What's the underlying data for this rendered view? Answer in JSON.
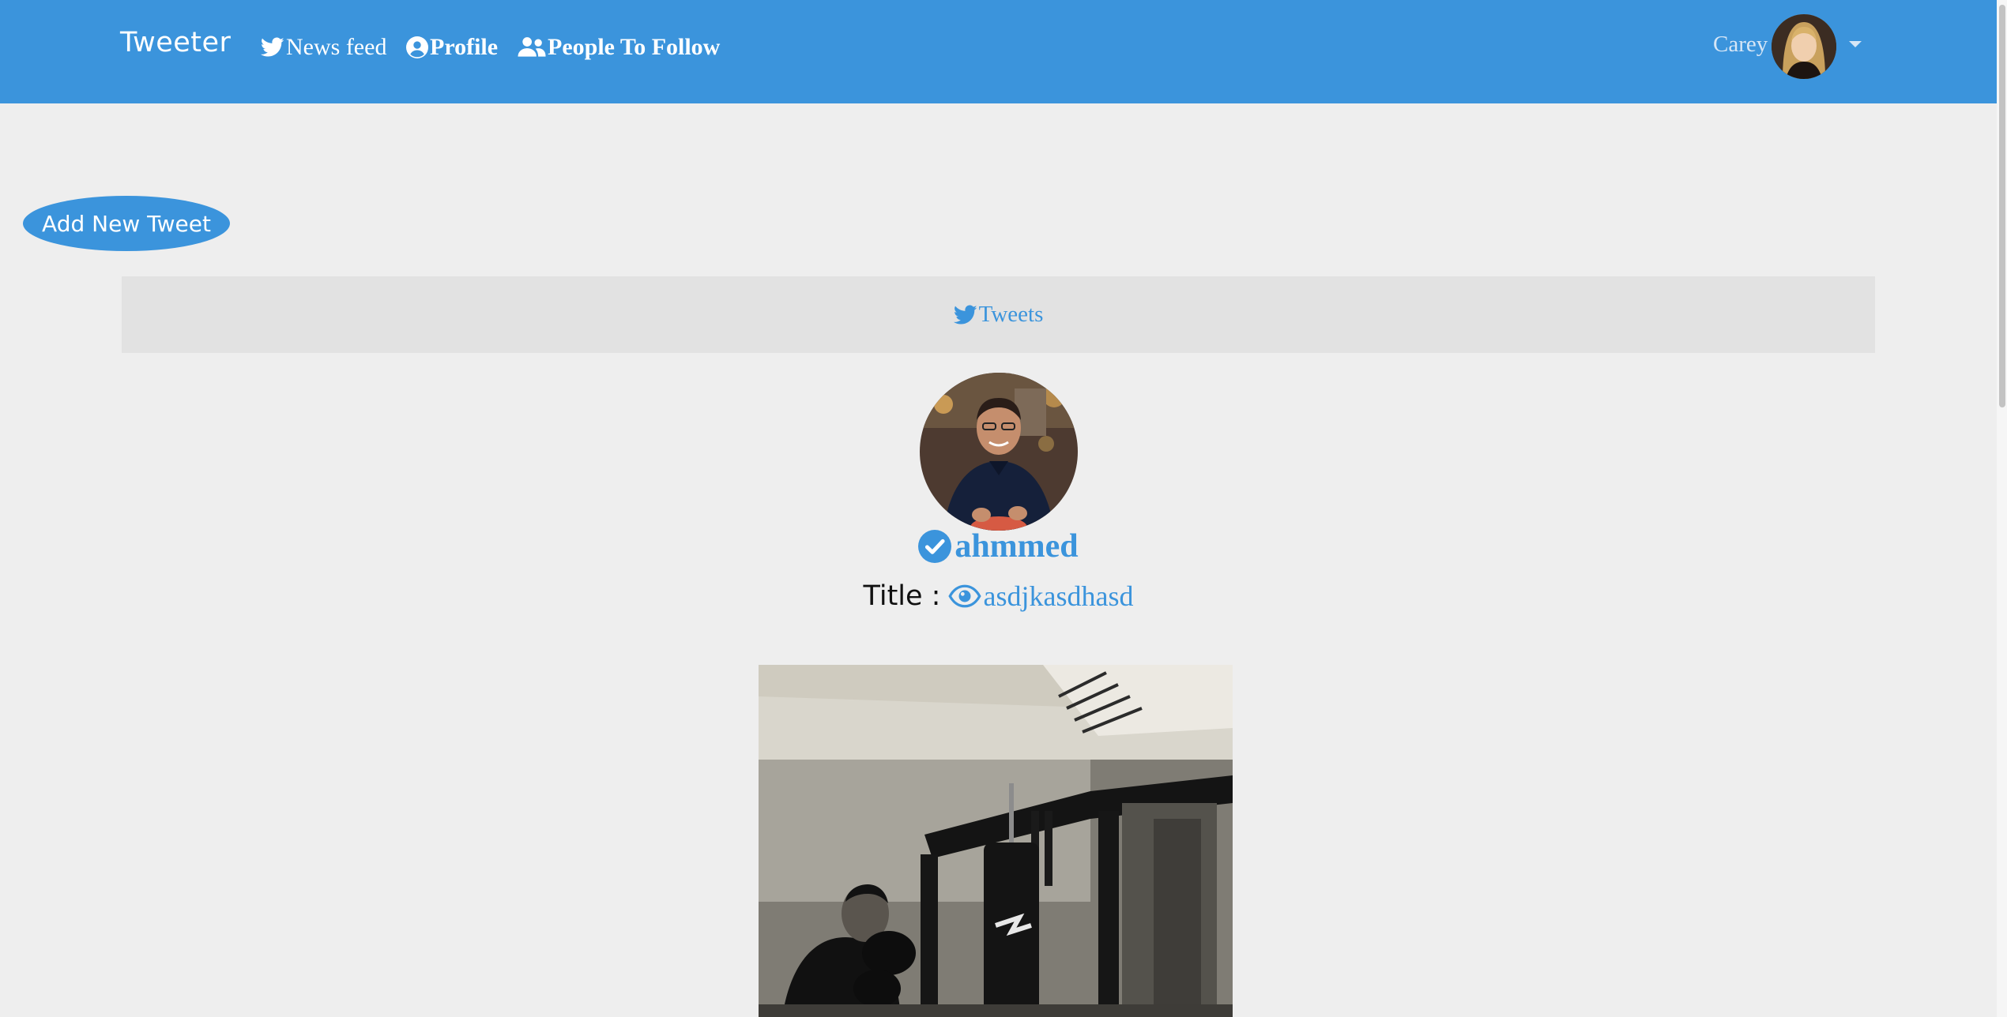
{
  "navbar": {
    "brand": "Tweeter",
    "items": [
      {
        "label": "News feed",
        "icon": "twitter-icon"
      },
      {
        "label": "Profile",
        "icon": "user-circle-icon"
      },
      {
        "label": "People To Follow",
        "icon": "users-icon"
      }
    ],
    "user": {
      "name": "Carey",
      "icon": "chevron-down-icon"
    }
  },
  "actions": {
    "add_tweet_label": "Add New Tweet"
  },
  "tweets_tab": {
    "label": "Tweets",
    "icon": "twitter-icon"
  },
  "tweet": {
    "author": "ahmmed",
    "verified_icon": "check-circle-icon",
    "title_label": "Title :",
    "title_value": "asdjkasdhasd",
    "title_icon": "eye-icon"
  },
  "colors": {
    "accent": "#3b94dc",
    "background": "#eeeeee",
    "tab_background": "#e2e2e2"
  }
}
